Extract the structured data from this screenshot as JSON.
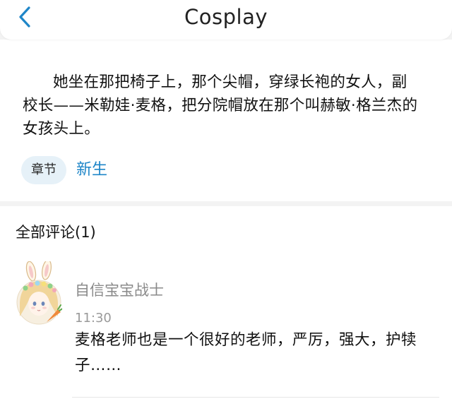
{
  "header": {
    "title": "Cosplay",
    "back_icon": "chevron-left-icon",
    "accent_color": "#1f86c8"
  },
  "story": {
    "text": "她坐在那把椅子上，那个尖帽，穿绿长袍的女人，副校长——米勒娃·麦格，把分院帽放在那个叫赫敏·格兰杰的女孩头上。",
    "tag_label": "章节",
    "chapter_name": "新生"
  },
  "comments": {
    "heading": "全部评论(1)",
    "items": [
      {
        "username": "自信宝宝战士",
        "time": "11:30",
        "text": "麦格老师也是一个很好的老师，严厉，强大，护犊子……",
        "avatar": "anime-girl-bunny-avatar"
      }
    ]
  }
}
